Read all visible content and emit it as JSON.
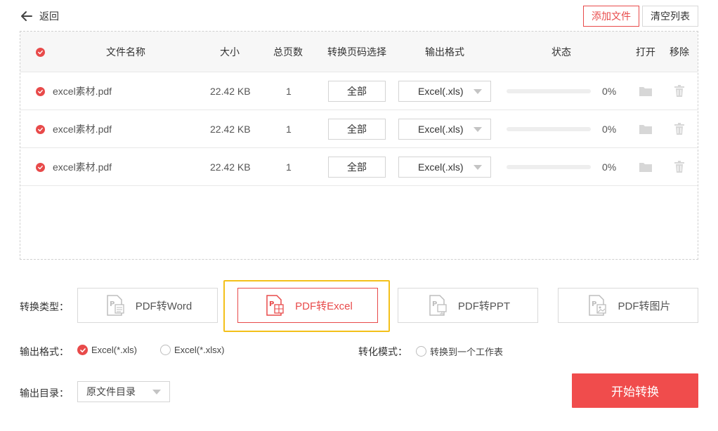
{
  "header": {
    "back_label": "返回",
    "add_file_label": "添加文件",
    "clear_list_label": "清空列表"
  },
  "table": {
    "columns": {
      "name": "文件名称",
      "size": "大小",
      "pages": "总页数",
      "page_select": "转换页码选择",
      "format": "输出格式",
      "status": "状态",
      "open": "打开",
      "remove": "移除"
    },
    "rows": [
      {
        "name": "excel素材.pdf",
        "size": "22.42 KB",
        "pages": "1",
        "page_select": "全部",
        "format": "Excel(.xls)",
        "progress": "0%"
      },
      {
        "name": "excel素材.pdf",
        "size": "22.42 KB",
        "pages": "1",
        "page_select": "全部",
        "format": "Excel(.xls)",
        "progress": "0%"
      },
      {
        "name": "excel素材.pdf",
        "size": "22.42 KB",
        "pages": "1",
        "page_select": "全部",
        "format": "Excel(.xls)",
        "progress": "0%"
      }
    ]
  },
  "conversion": {
    "type_label": "转换类型：",
    "types": [
      "PDF转Word",
      "PDF转Excel",
      "PDF转PPT",
      "PDF转图片"
    ],
    "selected_type": "PDF转Excel",
    "format_label": "输出格式：",
    "format_options": [
      "Excel(*.xls)",
      "Excel(*.xlsx)"
    ],
    "selected_format": "Excel(*.xls)",
    "mode_label": "转化模式：",
    "mode_option": "转换到一个工作表",
    "output_dir_label": "输出目录：",
    "output_dir_value": "原文件目录",
    "start_label": "开始转换"
  },
  "colors": {
    "accent": "#e84a4a",
    "highlight": "#f3c01a"
  }
}
